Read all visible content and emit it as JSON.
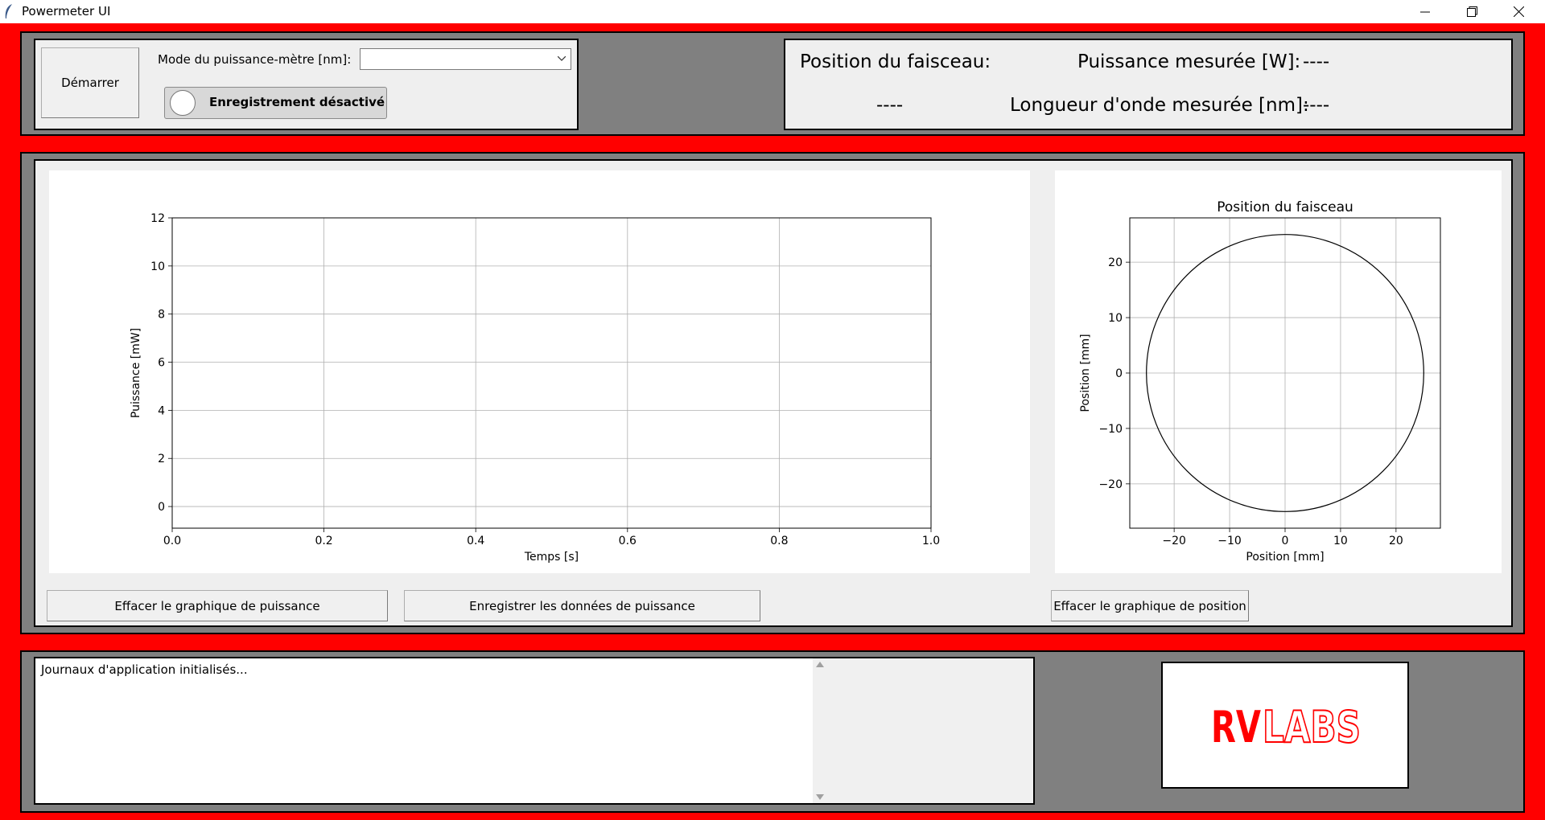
{
  "window": {
    "title": "Powermeter UI"
  },
  "controls": {
    "start_button": "Démarrer",
    "mode_label": "Mode du puissance-mètre [nm]:",
    "mode_value": "",
    "recording_toggle": "Enregistrement désactivé"
  },
  "readouts": {
    "beam_position_label": "Position du faisceau:",
    "beam_position_value": "----",
    "power_label": "Puissance mesurée [W]:",
    "power_value": "----",
    "wavelength_label": "Longueur d'onde mesurée [nm]:",
    "wavelength_value": "----"
  },
  "chart_data": [
    {
      "type": "line",
      "title": "",
      "xlabel": "Temps [s]",
      "ylabel": "Puissance [mW]",
      "xlim": [
        0.0,
        1.0
      ],
      "ylim": [
        -0.9,
        12
      ],
      "xticks": [
        "0.0",
        "0.2",
        "0.4",
        "0.6",
        "0.8",
        "1.0"
      ],
      "yticks": [
        "0",
        "2",
        "4",
        "6",
        "8",
        "10",
        "12"
      ],
      "grid": true,
      "series": []
    },
    {
      "type": "scatter",
      "title": "Position du faisceau",
      "xlabel": "Position [mm]",
      "ylabel": "Position [mm]",
      "xlim": [
        -28,
        28
      ],
      "ylim": [
        -28,
        28
      ],
      "xticks": [
        "−20",
        "−10",
        "0",
        "10",
        "20"
      ],
      "yticks": [
        "−20",
        "−10",
        "0",
        "10",
        "20"
      ],
      "grid": true,
      "circle_radius": 25,
      "series": []
    }
  ],
  "buttons": {
    "clear_power": "Effacer le graphique de puissance",
    "save_power": "Enregistrer les données de puissance",
    "clear_position": "Effacer le graphique de position"
  },
  "log": {
    "text": "Journaux d'application initialisés..."
  },
  "logo": {
    "text_bold": "RV",
    "text_outline": "LABS",
    "color": "#ff0000"
  },
  "colors": {
    "background": "#ff0000",
    "panel": "#808080",
    "inner_panel": "#efefef"
  }
}
